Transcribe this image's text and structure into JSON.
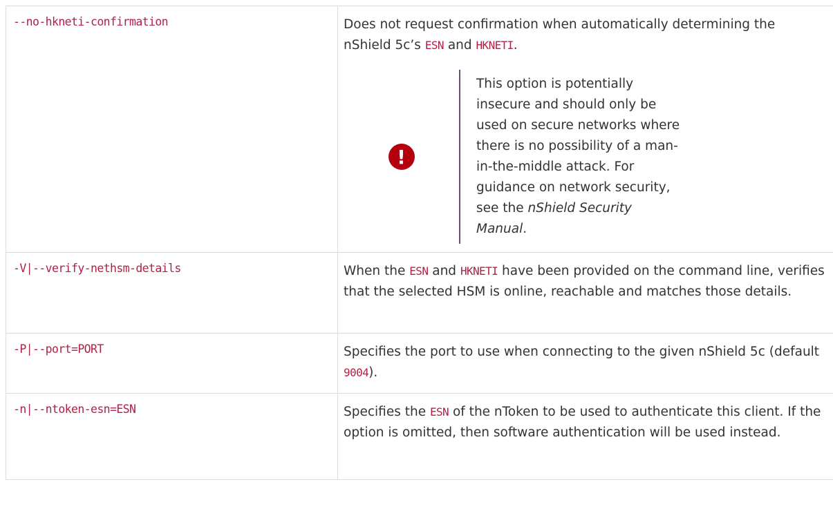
{
  "rows": [
    {
      "option": "--no-hkneti-confirmation",
      "desc_parts": [
        "Does not request confirmation when automatically determining the nShield 5c’s ",
        "ESN",
        " and ",
        "HKNETI",
        "."
      ],
      "admonition": {
        "icon": "exclamation-icon",
        "text_before": "This option is potentially insecure and should only be used on secure networks where there is no possibility of a man-in-the-middle attack. For guidance on network security, see the ",
        "text_emph": "nShield Security Manual",
        "text_after": "."
      }
    },
    {
      "option": "-V|--verify-nethsm-details",
      "desc_parts": [
        "When the ",
        "ESN",
        " and ",
        "HKNETI",
        " have been provided on the command line, verifies that the selected HSM is online, reachable and matches those details."
      ]
    },
    {
      "option": "-P|--port=PORT",
      "desc_parts": [
        "Specifies the port to use when connecting to the given nShield 5c (default ",
        "9004",
        ")."
      ]
    },
    {
      "option": "-n|--ntoken-esn=ESN",
      "desc_parts": [
        "Specifies the ",
        "ESN",
        " of the nToken to be used to authenticate this client. If the option is omitted, then software authentication will be used instead."
      ]
    }
  ],
  "colors": {
    "code": "#b12146",
    "warning": "#b4000d",
    "admonition_rule": "#6b4e71"
  }
}
